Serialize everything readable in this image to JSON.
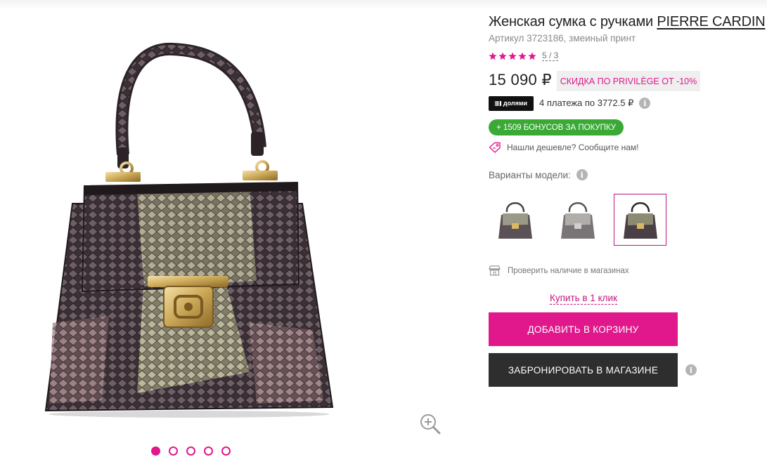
{
  "product": {
    "title_prefix": "Женская сумка с ручками ",
    "brand": "PIERRE CARDIN",
    "article": "Артикул 3723186, змеиный принт",
    "rating_text": "5 / 3",
    "rating_value": 5,
    "price": "15 090 ₽",
    "privilege_discount": "СКИДКА ПО PRIVILÈGE ОТ -10%",
    "dolyami_logo": "долями",
    "installments": "4 платежа по 3772.5 ₽",
    "bonus": "+ 1509 БОНУСОВ ЗА ПОКУПКУ",
    "found_cheaper": "Нашли дешевле? Сообщите нам!"
  },
  "variants": {
    "label": "Варианты модели:",
    "items": [
      {
        "name": "variant-1",
        "selected": false
      },
      {
        "name": "variant-2",
        "selected": false
      },
      {
        "name": "variant-3",
        "selected": true
      }
    ]
  },
  "actions": {
    "stock_check": "Проверить наличие в магазинах",
    "one_click": "Купить в 1 клик",
    "add_to_cart": "ДОБАВИТЬ В КОРЗИНУ",
    "reserve": "ЗАБРОНИРОВАТЬ В МАГАЗИНЕ"
  },
  "gallery": {
    "slide_count": 5,
    "active_slide": 1
  },
  "colors": {
    "accent": "#e0188c",
    "bonus_green": "#3aa935",
    "dark_button": "#2e2e2e"
  },
  "icons": {
    "zoom": "zoom-in-icon",
    "info": "info-icon",
    "tag": "price-tag-icon",
    "store": "store-icon",
    "star": "star-icon"
  }
}
